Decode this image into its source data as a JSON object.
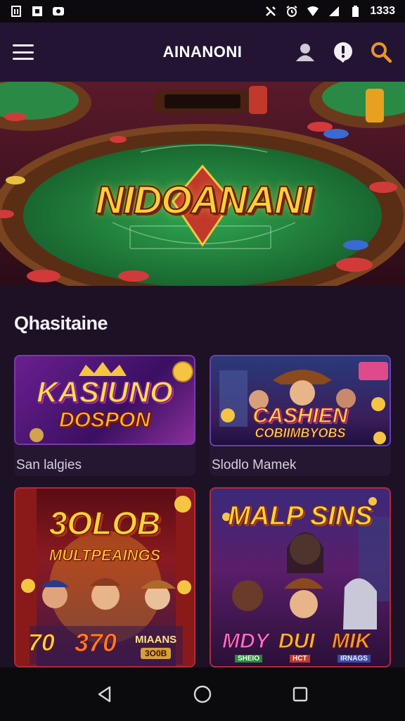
{
  "status_bar": {
    "time": "1333",
    "icons": [
      "sim-icon",
      "notification-icon",
      "vpn-icon",
      "nfc-icon",
      "alarm-icon",
      "wifi-icon",
      "signal-icon",
      "battery-icon"
    ]
  },
  "app_bar": {
    "title": "AINANONI",
    "menu_icon": "hamburger-icon",
    "actions": [
      "profile-icon",
      "info-icon",
      "search-icon"
    ]
  },
  "hero": {
    "banner_text": "NIDOANANI"
  },
  "section": {
    "heading": "Qhasitaine"
  },
  "games": [
    {
      "title_line1": "KASIUNO",
      "title_line2": "DOSPON",
      "label": "San lalgies"
    },
    {
      "title_line1": "CASHIEN",
      "title_line2": "COBIIMBYOBS",
      "label": "Slodlo Mamek"
    },
    {
      "title_line1": "3OLOB",
      "title_line2": "MULTPEAINGS",
      "caption_left": "70",
      "caption_mid": "370",
      "caption_right": "MIAANS",
      "caption_right_sub": "3O0B"
    },
    {
      "title_line1": "MALP SINS",
      "caption_left": "MDY",
      "caption_mid": "DUI",
      "caption_right": "MIK",
      "tag_left": "SHEIO",
      "tag_mid": "HCT",
      "tag_right": "IRNAGS"
    }
  ],
  "colors": {
    "background": "#1d1126",
    "app_bar": "#241433",
    "accent": "#e8962a",
    "table_felt": "#1f7a3a",
    "card_border_1": "#7a3aa8",
    "card_border_2": "#6a3fb0",
    "card_border_3": "#b02a3a"
  },
  "nav_bar": {
    "buttons": [
      "back-icon",
      "home-icon",
      "recents-icon"
    ]
  }
}
